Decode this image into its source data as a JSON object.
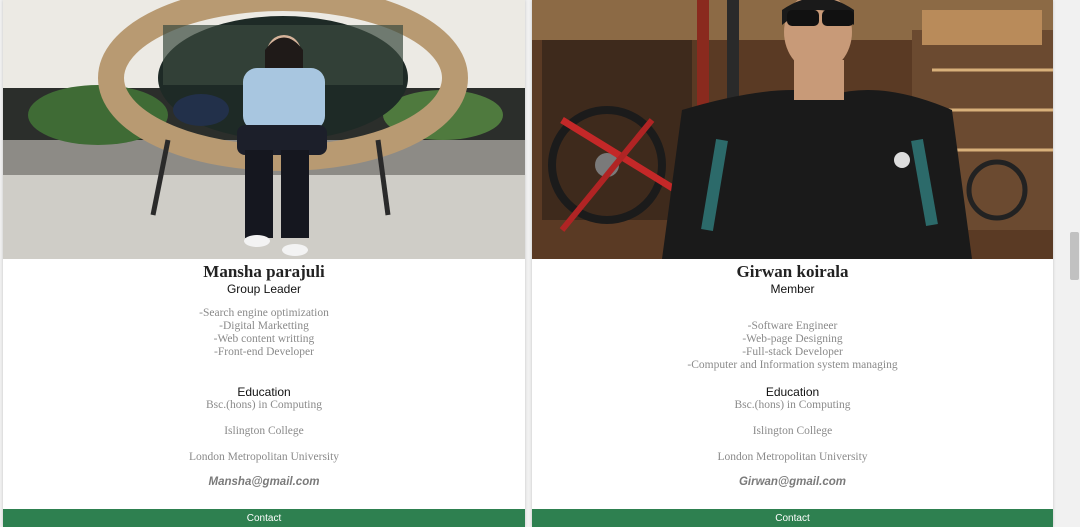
{
  "cards": [
    {
      "name": "Mansha parajuli",
      "role": "Group Leader",
      "skills": [
        "-Search engine optimization",
        "-Digital Marketting",
        "-Web content writting",
        "-Front-end Developer"
      ],
      "education_title": "Education",
      "degree": "Bsc.(hons) in Computing",
      "college": "Islington College",
      "university": "London Metropolitan University",
      "email": "Mansha@gmail.com",
      "contact_label": "Contact"
    },
    {
      "name": "Girwan koirala",
      "role": "Member",
      "skills": [
        "-Software Engineer",
        "-Web-page Designing",
        "-Full-stack Developer",
        "-Computer and Information system managing"
      ],
      "education_title": "Education",
      "degree": "Bsc.(hons) in Computing",
      "college": "Islington College",
      "university": "London Metropolitan University",
      "email": "Girwan@gmail.com",
      "contact_label": "Contact"
    }
  ],
  "colors": {
    "contact_bg": "#2e8050",
    "muted_text": "#8a8a8a"
  }
}
